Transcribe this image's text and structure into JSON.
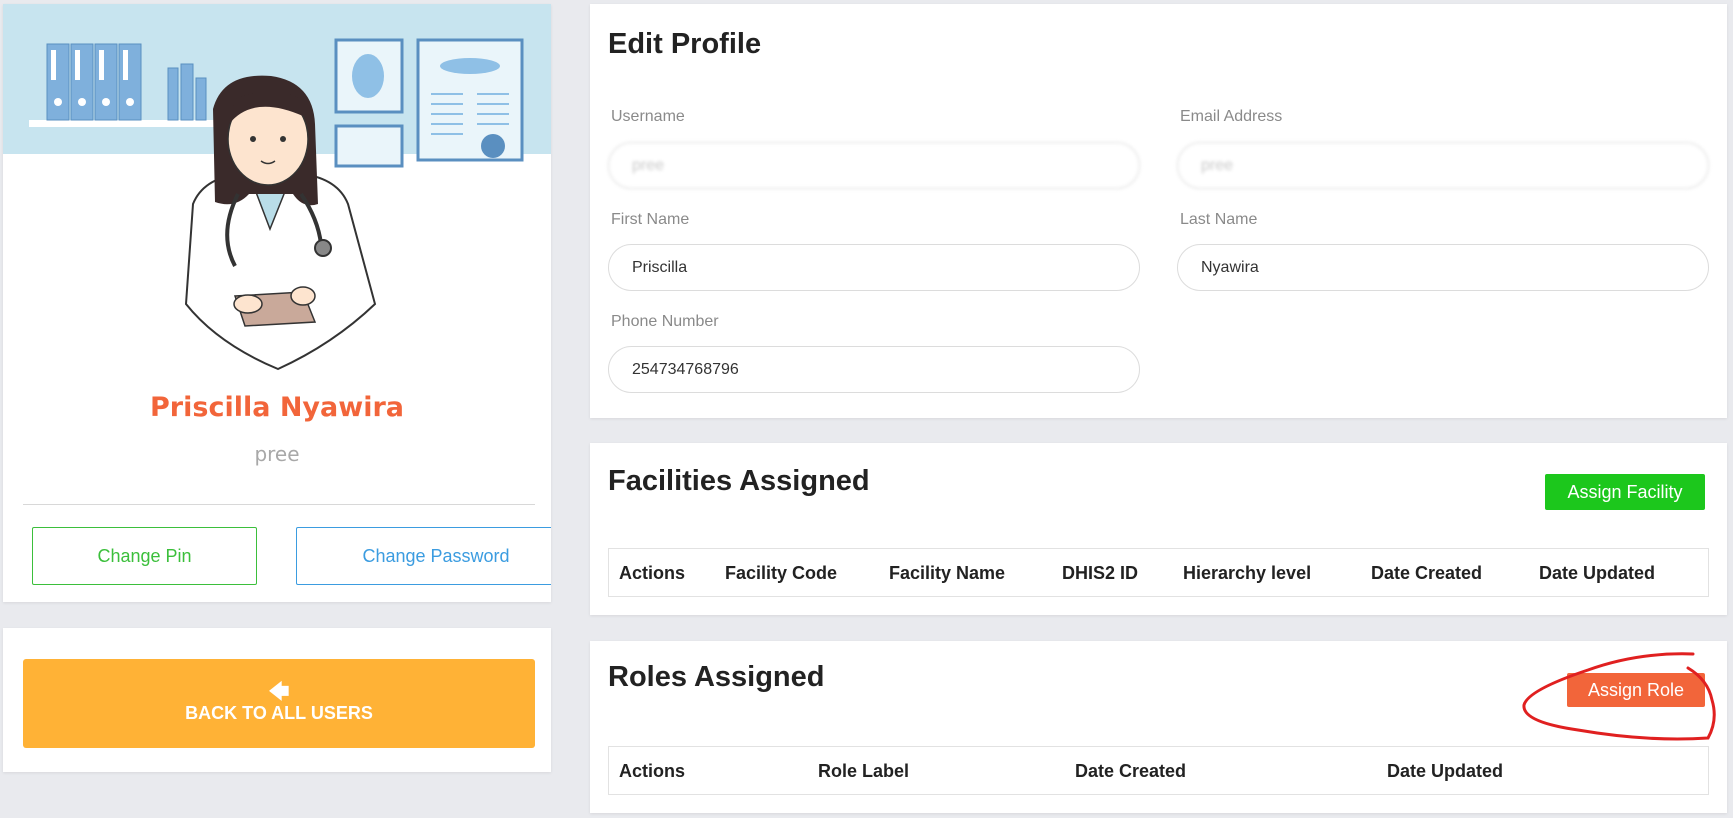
{
  "profile": {
    "full_name": "Priscilla Nyawira",
    "username": "pree",
    "change_pin_label": "Change Pin",
    "change_password_label": "Change Password"
  },
  "back": {
    "arrow_icon": "➔",
    "label": "BACK TO ALL USERS"
  },
  "edit_profile": {
    "title": "Edit Profile",
    "username_label": "Username",
    "username_value": "pree",
    "email_label": "Email Address",
    "email_value": "pree",
    "first_name_label": "First Name",
    "first_name_value": "Priscilla",
    "last_name_label": "Last Name",
    "last_name_value": "Nyawira",
    "phone_label": "Phone Number",
    "phone_value": "254734768796"
  },
  "facilities": {
    "title": "Facilities Assigned",
    "assign_label": "Assign Facility",
    "columns": [
      "Actions",
      "Facility Code",
      "Facility Name",
      "DHIS2 ID",
      "Hierarchy level",
      "Date Created",
      "Date Updated"
    ]
  },
  "roles": {
    "title": "Roles Assigned",
    "assign_label": "Assign Role",
    "columns": [
      "Actions",
      "Role Label",
      "Date Created",
      "Date Updated"
    ]
  },
  "colors": {
    "accent_orange": "#f2653a",
    "green": "#1cc71c",
    "blue": "#3b9ce0",
    "yellow": "#ffb236",
    "annotation_red": "#e02020"
  }
}
